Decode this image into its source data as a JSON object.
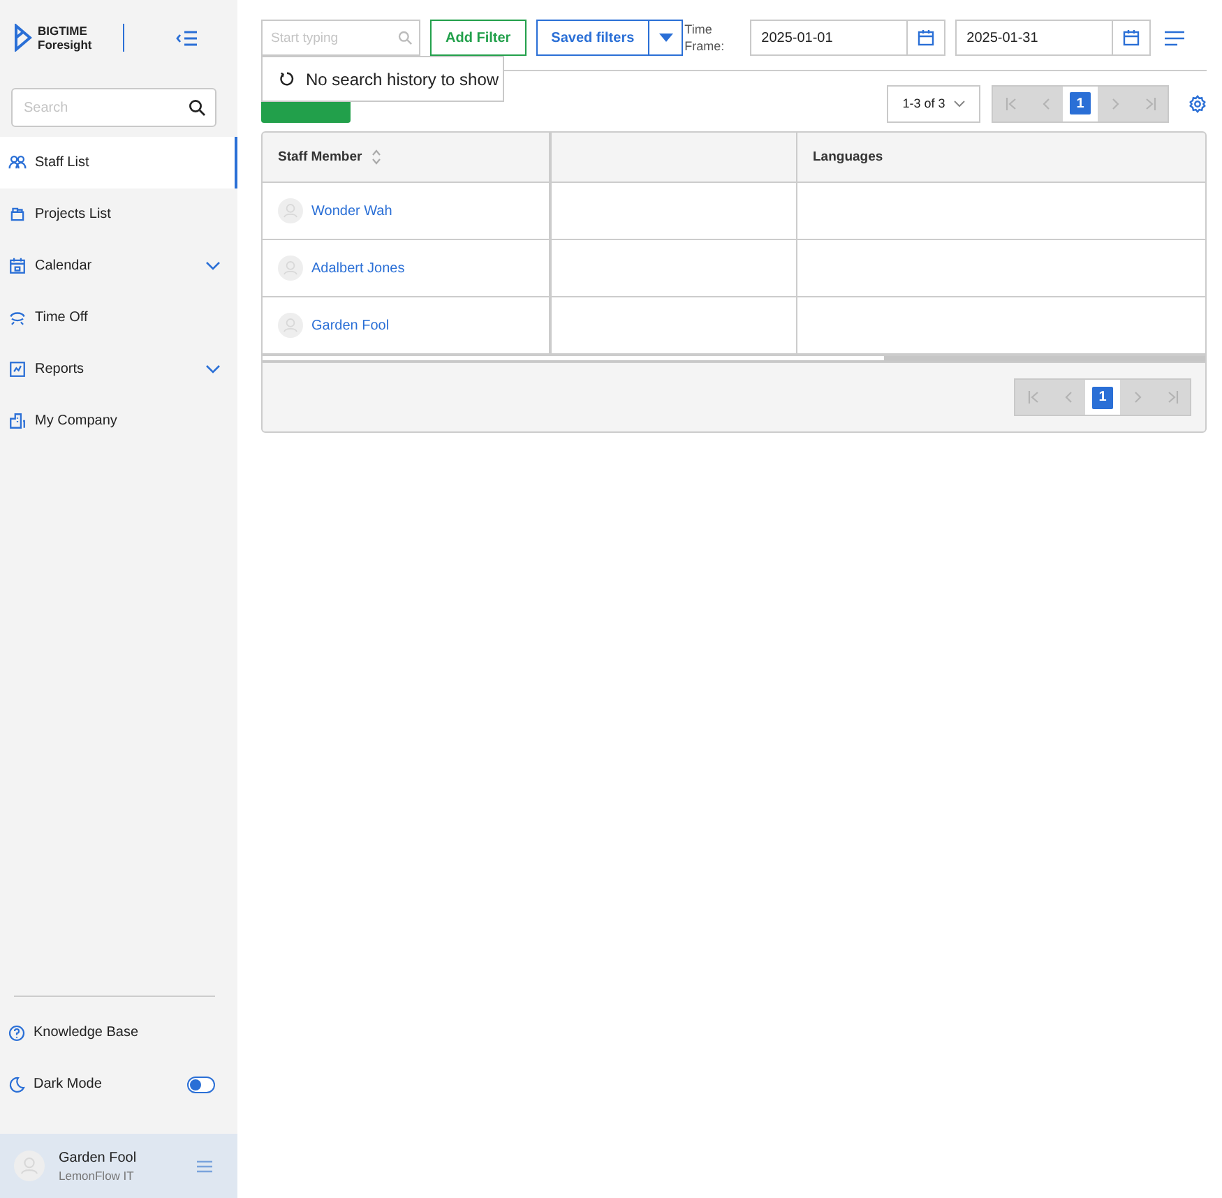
{
  "sidebar": {
    "logo": {
      "line1": "BIGTIME",
      "line2": "Foresight"
    },
    "search": {
      "placeholder": "Search"
    },
    "items": [
      {
        "label": "Staff List",
        "kind": "people",
        "selected": true,
        "expandable": false
      },
      {
        "label": "Projects List",
        "kind": "folder",
        "selected": false,
        "expandable": false
      },
      {
        "label": "Calendar",
        "kind": "calendar",
        "selected": false,
        "expandable": true
      },
      {
        "label": "Time Off",
        "kind": "plane",
        "selected": false,
        "expandable": false
      },
      {
        "label": "Reports",
        "kind": "report",
        "selected": false,
        "expandable": true
      },
      {
        "label": "My Company",
        "kind": "building",
        "selected": false,
        "expandable": false
      }
    ],
    "knowledge_base": "Knowledge Base",
    "dark_mode": {
      "label": "Dark Mode",
      "on": false
    },
    "user": {
      "name": "Garden Fool",
      "company": "LemonFlow IT"
    }
  },
  "toolbar": {
    "search": {
      "placeholder": "Start typing"
    },
    "add_filter": "Add Filter",
    "saved_filters": "Saved filters",
    "time_frame_label": "Time Frame:",
    "date_from": "2025-01-01",
    "date_to": "2025-01-31"
  },
  "search_history": "No search history to show",
  "pager": {
    "range": "1-3 of 3",
    "page": "1"
  },
  "table": {
    "columns": [
      {
        "label": "Staff Member",
        "sortable": true
      },
      {
        "sortable": false
      },
      {
        "label": "Languages",
        "sortable": false
      }
    ],
    "rows": [
      {
        "name": "Wonder Wah"
      },
      {
        "name": "Adalbert Jones"
      },
      {
        "name": "Garden Fool"
      }
    ],
    "footer_page": "1"
  }
}
